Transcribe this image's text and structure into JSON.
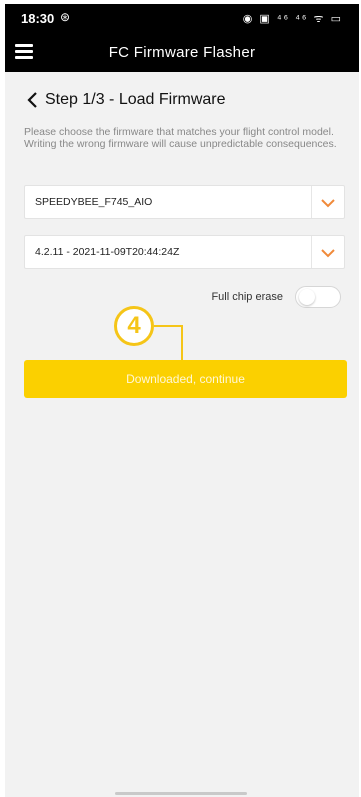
{
  "status_bar": {
    "time": "18:30",
    "time_icon": "⊛",
    "indicators": "◉ ▣ ⁴⁶ ⁴⁶ ᯤ ▭"
  },
  "app_bar": {
    "title": "FC Firmware Flasher",
    "menu_icon": "hamburger-menu-icon"
  },
  "step": {
    "title": "Step 1/3 - Load Firmware",
    "back_icon": "chevron-left-icon"
  },
  "description": "Please choose the firmware that matches your flight control model. Writing the wrong firmware will cause unpredictable consequences.",
  "board_select": {
    "value": "SPEEDYBEE_F745_AIO"
  },
  "version_select": {
    "value": "4.2.11 - 2021-11-09T20:44:24Z"
  },
  "full_chip_erase": {
    "label": "Full chip erase",
    "enabled": false
  },
  "annotation": {
    "number": "4"
  },
  "continue_button": {
    "label": "Downloaded, continue"
  },
  "colors": {
    "accent": "#fbd000",
    "chevron": "#f08a3a",
    "annotation": "#f5c518"
  }
}
